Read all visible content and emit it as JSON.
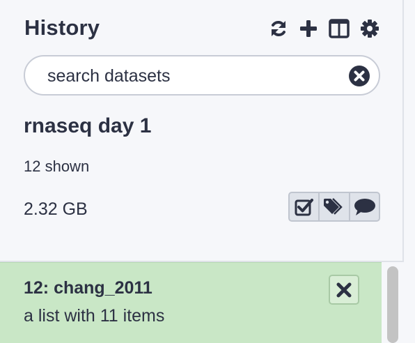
{
  "header": {
    "title": "History",
    "icons": [
      "refresh-icon",
      "plus-icon",
      "columns-icon",
      "gear-icon"
    ]
  },
  "search": {
    "placeholder": "search datasets",
    "value": ""
  },
  "history": {
    "name": "rnaseq day 1",
    "shown": "12 shown",
    "size": "2.32 GB",
    "actions": [
      "select-all-icon",
      "tags-icon",
      "annotation-icon"
    ]
  },
  "datasets": [
    {
      "title": "12: chang_2011",
      "subtitle": "a list with 11 items",
      "state_color": "#c9e7c6"
    }
  ],
  "colors": {
    "text": "#2c3143",
    "panel_bg": "#f6f7fa",
    "ok_state": "#c9e7c6"
  }
}
